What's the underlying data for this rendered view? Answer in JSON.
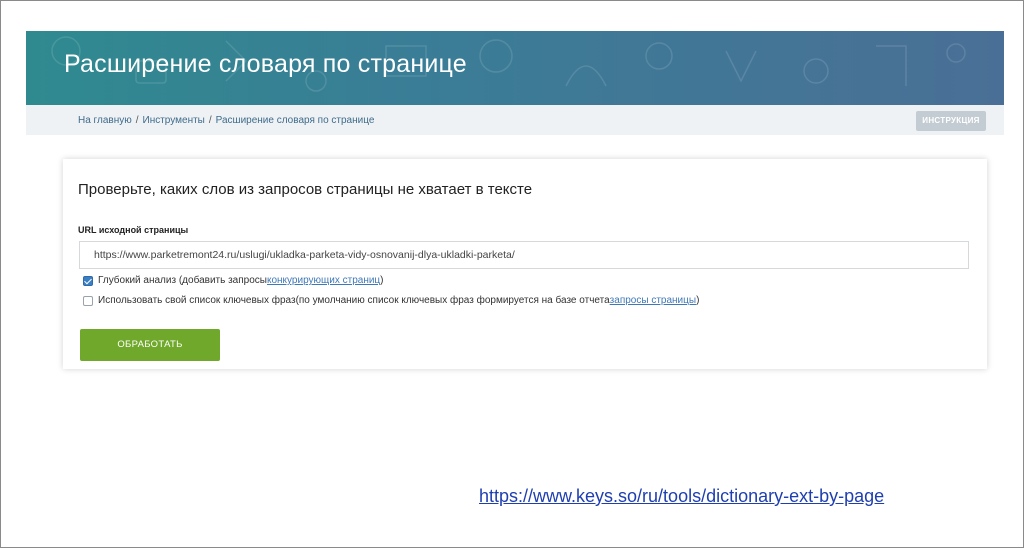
{
  "banner": {
    "title": "Расширение словаря по странице"
  },
  "breadcrumb": {
    "items": [
      "На главную",
      "Инструменты",
      "Расширение словаря по странице"
    ],
    "separator": "/"
  },
  "instruction_button": {
    "label": "ИНСТРУКЦИЯ"
  },
  "form": {
    "heading": "Проверьте, каких слов из запросов страницы не хватает в тексте",
    "url_label": "URL исходной страницы",
    "url_value": "https://www.parketremont24.ru/uslugi/ukladka-parketa-vidy-osnovanij-dlya-ukladki-parketa/",
    "option_deep": {
      "checked": true,
      "text_before": "Глубокий анализ (добавить запросы ",
      "link_text": "конкурирующих страниц",
      "text_after": ")"
    },
    "option_own_list": {
      "checked": false,
      "text_before": "Использовать свой список ключевых фраз(по умолчанию список ключевых фраз формируется на базе отчета ",
      "link_text": "запросы страницы",
      "text_after": ")"
    },
    "submit_label": "ОБРАБОТАТЬ"
  },
  "footer": {
    "link": "https://www.keys.so/ru/tools/dictionary-ext-by-page"
  },
  "colors": {
    "banner_start": "#2f8a8f",
    "banner_end": "#4a6f96",
    "submit": "#6fa82a",
    "link": "#3f78b8",
    "footer_link": "#1f3fb0"
  }
}
